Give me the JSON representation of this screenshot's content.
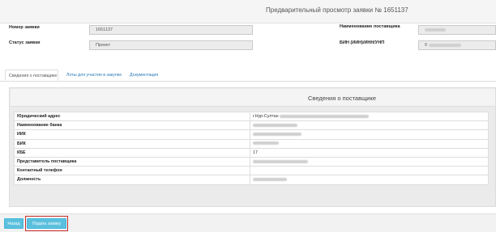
{
  "header": {
    "title": "Предварительный просмотр заявки № 1651137"
  },
  "form": {
    "request_number_label": "Номер заявки",
    "request_number_value": "1651137",
    "status_label": "Статус заявки",
    "status_value": "Проект",
    "supplier_name_label": "Наименование поставщика",
    "supplier_bin_label": "БИН (ИИН)/ИНН/УНП",
    "supplier_bin_value": "0"
  },
  "tabs": [
    {
      "label": "Сведения о поставщике",
      "active": true
    },
    {
      "label": "Лоты для участия в закупке",
      "active": false
    },
    {
      "label": "Документация",
      "active": false
    }
  ],
  "panel": {
    "title": "Сведения о поставщике"
  },
  "info_rows": [
    {
      "key": "Юридический адрес",
      "value": "г.Нур-Султан"
    },
    {
      "key": "Наименование банка",
      "value": ""
    },
    {
      "key": "ИИК",
      "value": ""
    },
    {
      "key": "БИК",
      "value": ""
    },
    {
      "key": "КБЕ",
      "value": "17"
    },
    {
      "key": "Представитель поставщика",
      "value": ""
    },
    {
      "key": "Контактный телефон",
      "value": ""
    },
    {
      "key": "Должность",
      "value": ""
    }
  ],
  "footer": {
    "back_label": "Назад",
    "submit_label": "Подать заявку"
  },
  "colors": {
    "button": "#5bc0de",
    "highlight": "#c9302c",
    "link": "#2a7ab8"
  }
}
